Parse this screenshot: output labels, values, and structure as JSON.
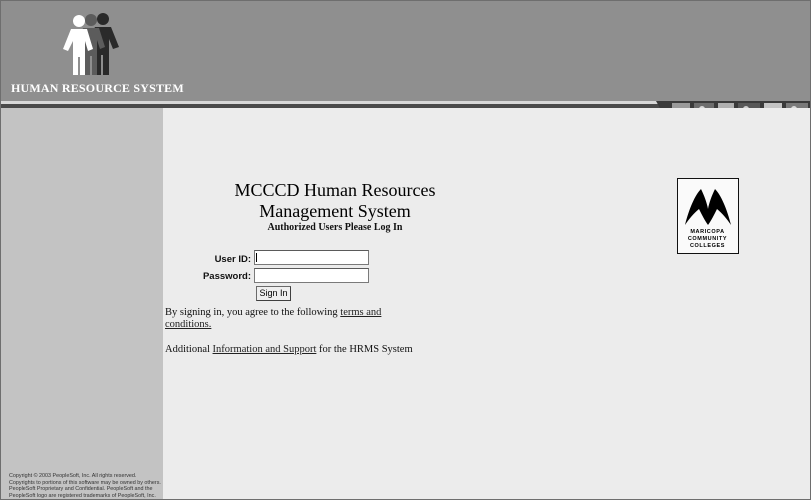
{
  "header": {
    "system_title": "HUMAN RESOURCE SYSTEM"
  },
  "login": {
    "title_line1": "MCCCD Human Resources",
    "title_line2": "Management System",
    "subtitle": "Authorized Users Please Log In",
    "userid_label": "User ID:",
    "password_label": "Password:",
    "userid_value": "",
    "password_value": "",
    "signin_label": "Sign In",
    "terms_prefix": "By signing in, you agree to the following ",
    "terms_link": "terms and conditions.",
    "support_prefix": "Additional ",
    "support_link": "Information and Support",
    "support_suffix": " for the HRMS System"
  },
  "college_logo": {
    "line1": "MARICOPA",
    "line2": "COMMUNITY",
    "line3": "COLLEGES"
  },
  "sidebar": {
    "copyright": "Copyright © 2003 PeopleSoft, Inc. All rights reserved. Copyrights to portions of this software may be owned by others. PeopleSoft Proprietary and Confidential. PeopleSoft and the PeopleSoft logo are registered trademarks of PeopleSoft, Inc."
  },
  "colors": {
    "header_bg": "#8f8f8f",
    "sidebar_bg": "#c3c3c3",
    "main_bg": "#ececec"
  },
  "icons": [
    "people-figures-logo",
    "photo-strip-banner",
    "maricopa-m-logo"
  ]
}
